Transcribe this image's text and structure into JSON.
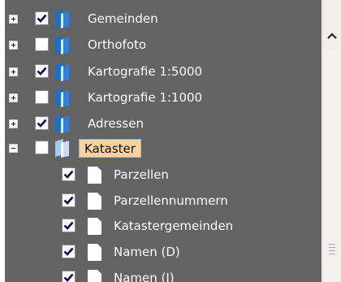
{
  "tree": {
    "items": [
      {
        "label": "Gemeinden",
        "expander": "plus",
        "checked": true,
        "icon": "layer-group-folder-icon",
        "selected": false
      },
      {
        "label": "Orthofoto",
        "expander": "plus",
        "checked": false,
        "icon": "layer-group-folder-icon",
        "selected": false
      },
      {
        "label": "Kartografie 1:5000",
        "expander": "plus",
        "checked": true,
        "icon": "layer-group-folder-icon",
        "selected": false
      },
      {
        "label": "Kartografie 1:1000",
        "expander": "plus",
        "checked": false,
        "icon": "layer-group-folder-icon",
        "selected": false
      },
      {
        "label": "Adressen",
        "expander": "plus",
        "checked": true,
        "icon": "layer-group-folder-icon",
        "selected": false
      },
      {
        "label": "Kataster",
        "expander": "minus",
        "checked": false,
        "icon": "layer-group-folder-icon",
        "selected": true
      },
      {
        "label": "Parzellen",
        "expander": null,
        "checked": true,
        "icon": "layer-page-icon",
        "selected": false
      },
      {
        "label": "Parzellennummern",
        "expander": null,
        "checked": true,
        "icon": "layer-page-icon",
        "selected": false
      },
      {
        "label": "Katastergemeinden",
        "expander": null,
        "checked": true,
        "icon": "layer-page-icon",
        "selected": false
      },
      {
        "label": "Namen (D)",
        "expander": null,
        "checked": true,
        "icon": "layer-page-icon",
        "selected": false
      },
      {
        "label": "Namen (I)",
        "expander": null,
        "checked": true,
        "icon": "layer-page-icon",
        "selected": false
      }
    ]
  },
  "colors": {
    "panel_background": "#636363",
    "label_text": "#ffffff",
    "selected_background": "#f8d3a0",
    "selected_border": "#e9a94f",
    "folder_blue": "#2f7fd6",
    "checkmark": "#0a0a5a"
  },
  "scrollbar": {
    "up_arrow_icon": "chevron-up-icon",
    "grip_icon": "scroll-grip-icon"
  }
}
